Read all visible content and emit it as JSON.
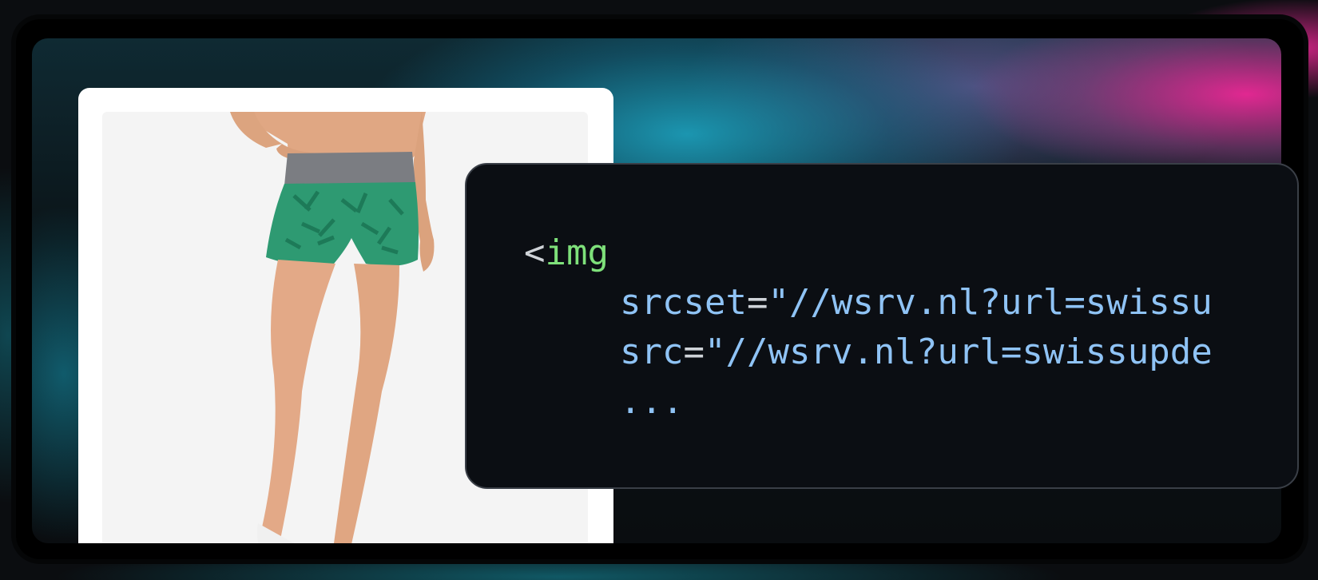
{
  "product_image": {
    "alt": "woman wearing green patterned shorts with grey waistband",
    "colors": {
      "shorts": "#2e9a72",
      "waistband": "#7b7d82",
      "background": "#f4f4f4"
    }
  },
  "code": {
    "open_bracket": "<",
    "tag": "img",
    "line2_attr": "srcset",
    "line2_eq": "=",
    "line2_value": "\"//wsrv.nl?url=swissu",
    "line3_attr": "src",
    "line3_eq": "=",
    "line3_value": "\"//wsrv.nl?url=swissupde",
    "line4": "..."
  },
  "colors": {
    "accent_pink": "#ec2896",
    "accent_teal": "#1ea8c8",
    "code_background": "#0b0e13",
    "code_tag": "#7ee07a",
    "code_attr": "#8fc3f5"
  }
}
